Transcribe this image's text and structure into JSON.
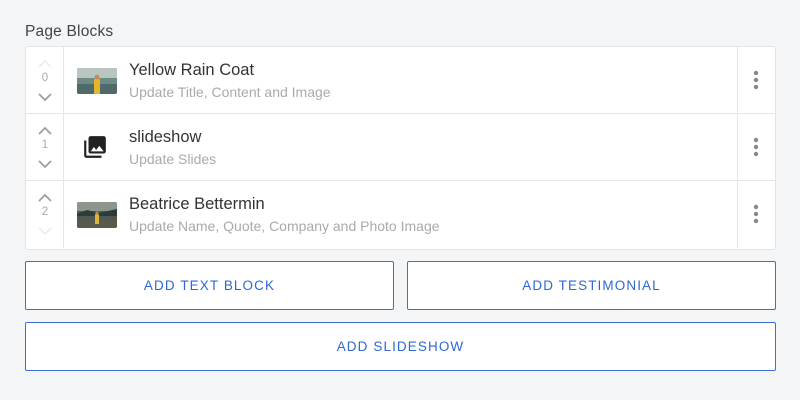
{
  "section_title": "Page Blocks",
  "blocks": [
    {
      "index": "0",
      "title": "Yellow Rain Coat",
      "subtitle": "Update Title, Content and Image",
      "icon": "image-thumbnail-icon",
      "up_enabled": false,
      "down_enabled": true
    },
    {
      "index": "1",
      "title": "slideshow",
      "subtitle": "Update Slides",
      "icon": "photo-library-icon",
      "up_enabled": true,
      "down_enabled": true
    },
    {
      "index": "2",
      "title": "Beatrice Bettermin",
      "subtitle": "Update Name, Quote, Company and Photo Image",
      "icon": "image-thumbnail-icon",
      "up_enabled": true,
      "down_enabled": false
    }
  ],
  "buttons": {
    "add_text_block": "ADD TEXT BLOCK",
    "add_testimonial": "ADD TESTIMONIAL",
    "add_slideshow": "ADD SLIDESHOW"
  },
  "colors": {
    "accent": "#2e68d4",
    "background": "#f4f5f7",
    "border": "#e1e3e6"
  }
}
